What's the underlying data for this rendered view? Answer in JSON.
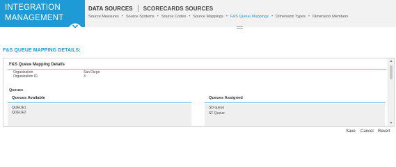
{
  "brand": {
    "line1": "INTEGRATION",
    "line2": "MANAGEMENT"
  },
  "topnav": {
    "tabs": [
      {
        "label": "DATA SOURCES"
      },
      {
        "label": "SCORECARDS SOURCES"
      }
    ]
  },
  "subnav": {
    "items": [
      {
        "label": "Source Measures"
      },
      {
        "label": "Source Systems"
      },
      {
        "label": "Source Codes"
      },
      {
        "label": "Source Mappings"
      },
      {
        "label": "F&S Queue Mappings"
      },
      {
        "label": "Dimension Types"
      },
      {
        "label": "Dimension Members"
      }
    ],
    "active_index": 4
  },
  "page": {
    "title": "F&S QUEUE MAPPING DETAILS:"
  },
  "details": {
    "section_title": "F&S Queue Mapping Details",
    "fields": [
      {
        "label": "Organization",
        "value": "San Diego"
      },
      {
        "label": "Organization ID",
        "value": "3"
      }
    ]
  },
  "queues": {
    "label": "Queues",
    "available": {
      "title": "Queues Available",
      "items": [
        "QUEUE1",
        "QUEUE2"
      ]
    },
    "assigned": {
      "title": "Queues Assigned",
      "items": [
        "SD queue",
        "SF Queue"
      ]
    }
  },
  "actions": {
    "save": "Save",
    "cancel": "Cancel",
    "revert": "Revert"
  },
  "colors": {
    "accent": "#1e9ad6",
    "header_bg": "#f2f2f2",
    "list_bg": "#efefef"
  }
}
